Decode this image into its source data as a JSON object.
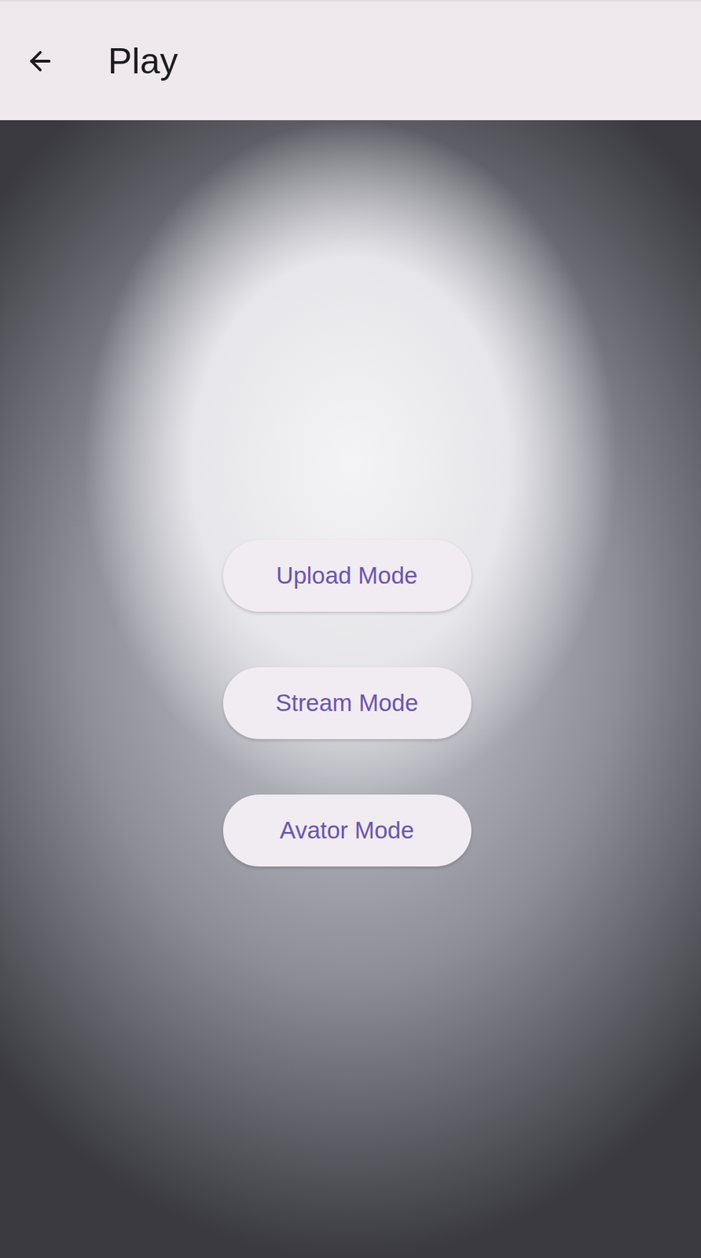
{
  "app_bar": {
    "title": "Play"
  },
  "illustration": {
    "kind": "picture"
  },
  "mode_buttons": [
    {
      "label": "Upload Mode"
    },
    {
      "label": "Stream Mode"
    },
    {
      "label": "Avator Mode"
    }
  ]
}
